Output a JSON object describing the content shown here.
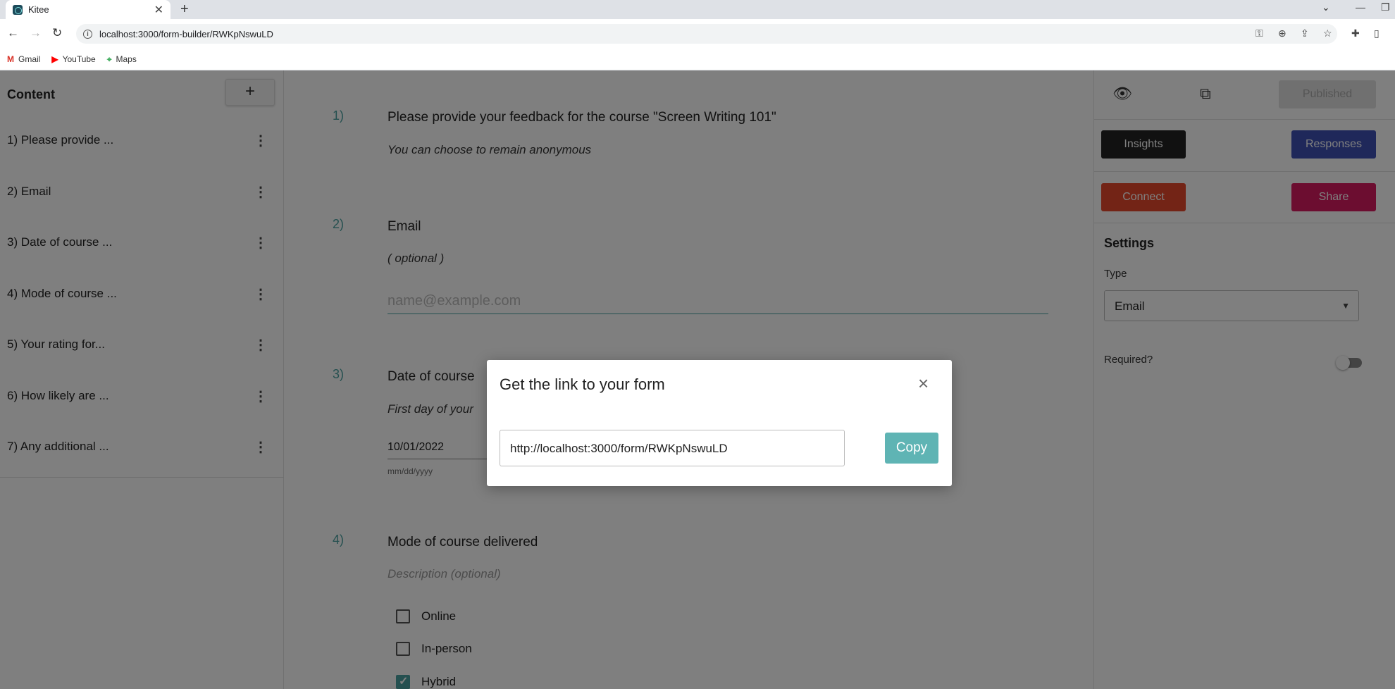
{
  "browser": {
    "tab_title": "Kitee",
    "tab_close": "✕",
    "new_tab": "+",
    "url": "localhost:3000/form-builder/RWKpNswuLD",
    "bookmarks": [
      {
        "label": "Gmail",
        "icon": "gmail-icon"
      },
      {
        "label": "YouTube",
        "icon": "youtube-icon"
      },
      {
        "label": "Maps",
        "icon": "maps-icon"
      }
    ]
  },
  "sidebar": {
    "title": "Content",
    "add_label": "+",
    "items": [
      {
        "label": "1) Please provide ..."
      },
      {
        "label": "2) Email"
      },
      {
        "label": "3) Date of course ..."
      },
      {
        "label": "4) Mode of course ..."
      },
      {
        "label": "5) Your rating for..."
      },
      {
        "label": "6) How likely are ..."
      },
      {
        "label": "7) Any additional ..."
      }
    ]
  },
  "main": {
    "q1": {
      "num": "1)",
      "title": "Please provide your feedback for the course \"Screen Writing 101\"",
      "desc": "You can choose to remain anonymous"
    },
    "q2": {
      "num": "2)",
      "title": "Email",
      "desc": "( optional )",
      "placeholder": "name@example.com"
    },
    "q3": {
      "num": "3)",
      "title": "Date of course",
      "desc": "First day of your",
      "value": "10/01/2022",
      "hint": "mm/dd/yyyy"
    },
    "q4": {
      "num": "4)",
      "title": "Mode of course delivered",
      "desc": "Description (optional)",
      "options": [
        {
          "label": "Online",
          "checked": false
        },
        {
          "label": "In-person",
          "checked": false
        },
        {
          "label": "Hybrid",
          "checked": true
        }
      ]
    }
  },
  "right_panel": {
    "published": "Published",
    "insights": "Insights",
    "responses": "Responses",
    "connect": "Connect",
    "share": "Share",
    "settings_title": "Settings",
    "type_label": "Type",
    "type_value": "Email",
    "required_label": "Required?",
    "required": false
  },
  "modal": {
    "title": "Get the link to your form",
    "link": "http://localhost:3000/form/RWKpNswuLD",
    "copy": "Copy",
    "close": "×"
  },
  "colors": {
    "accent": "#4aa0a0",
    "insights": "#222222",
    "responses": "#3f51b5",
    "connect": "#e6492d",
    "share": "#d81b60",
    "copy": "#5fb4b4"
  }
}
